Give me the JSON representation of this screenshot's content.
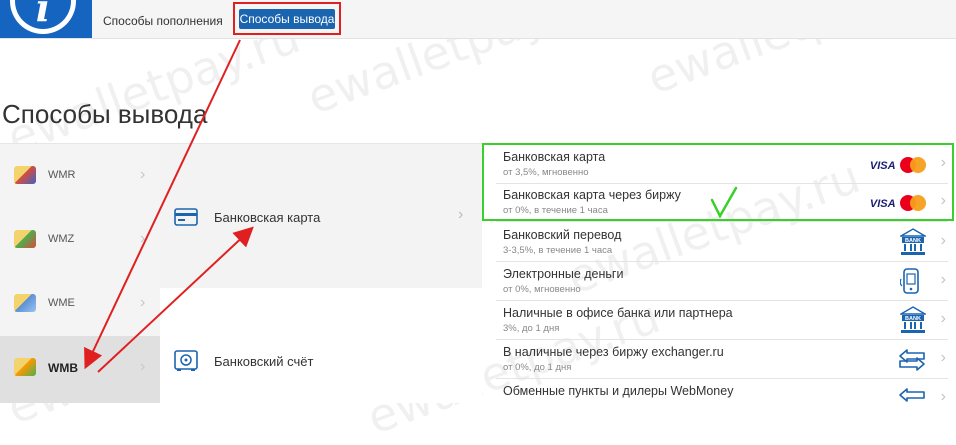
{
  "header": {
    "logo_letter": "i",
    "tabs": [
      {
        "label": "Способы пополнения"
      },
      {
        "label": "Способы вывода"
      }
    ]
  },
  "page_title": "Способы вывода",
  "currencies": [
    {
      "label": "WMR",
      "icon": "wmr-wallet-icon",
      "color": "#d94c3c"
    },
    {
      "label": "WMZ",
      "icon": "wmz-wallet-icon",
      "color": "#4caf50"
    },
    {
      "label": "WME",
      "icon": "wme-wallet-icon",
      "color": "#5b8fd6"
    },
    {
      "label": "WMB",
      "icon": "wmb-wallet-icon",
      "color": "#ff9800"
    }
  ],
  "categories": [
    {
      "label": "Банковская карта",
      "icon": "card-icon"
    },
    {
      "label": "Банковский счёт",
      "icon": "safe-icon"
    }
  ],
  "methods": [
    {
      "title": "Банковская карта",
      "sub": "от 3,5%, мгновенно",
      "icon": "visa-mastercard-icon"
    },
    {
      "title": "Банковская карта через биржу",
      "sub": "от 0%, в течение 1 часа",
      "icon": "visa-mastercard-icon"
    },
    {
      "title": "Банковский перевод",
      "sub": "3-3,5%, в течение 1 часа",
      "icon": "bank-icon"
    },
    {
      "title": "Электронные деньги",
      "sub": "от 0%, мгновенно",
      "icon": "mobile-money-icon"
    },
    {
      "title": "Наличные в офисе банка или партнера",
      "sub": "3%, до 1 дня",
      "icon": "bank-icon"
    },
    {
      "title": "В наличные через биржу exchanger.ru",
      "sub": "от 0%, до 1 дня",
      "icon": "exchange-arrows-icon"
    },
    {
      "title": "Обменные пункты и дилеры WebMoney",
      "sub": "",
      "icon": "exchange-arrows-icon"
    }
  ],
  "brand": {
    "visa": "VISA",
    "bank": "BANK"
  },
  "watermark": "ewalletpay.ru",
  "colors": {
    "accent": "#1a64b0",
    "highlight_red": "#e02020",
    "highlight_green": "#39d02c"
  }
}
